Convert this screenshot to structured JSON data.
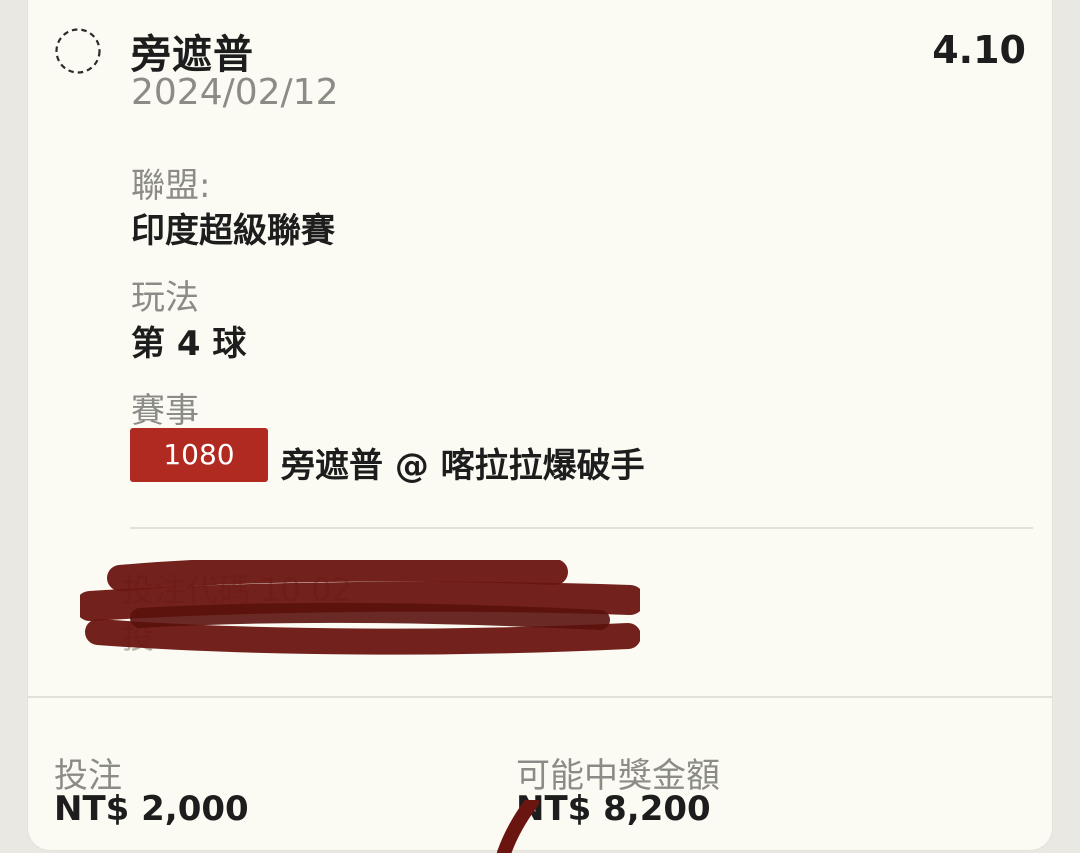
{
  "bet": {
    "team": "旁遮普",
    "date": "2024/02/12",
    "odds": "4.10"
  },
  "details": {
    "league_label": "聯盟:",
    "league_value": "印度超級聯賽",
    "play_label": "玩法",
    "play_value": "第 4 球",
    "match_label": "賽事",
    "match_id": "1080",
    "match_name": "旁遮普 @ 喀拉拉爆破手"
  },
  "redacted": {
    "line1": "投注代碼 10 02",
    "line2": "投"
  },
  "footer": {
    "stake_label": "投注",
    "stake_value": "NT$ 2,000",
    "payout_label": "可能中獎金額",
    "payout_value": "NT$ 8,200"
  },
  "colors": {
    "badge": "#b02a22",
    "redaction": "#6a1510",
    "card": "#fcfbf3"
  }
}
